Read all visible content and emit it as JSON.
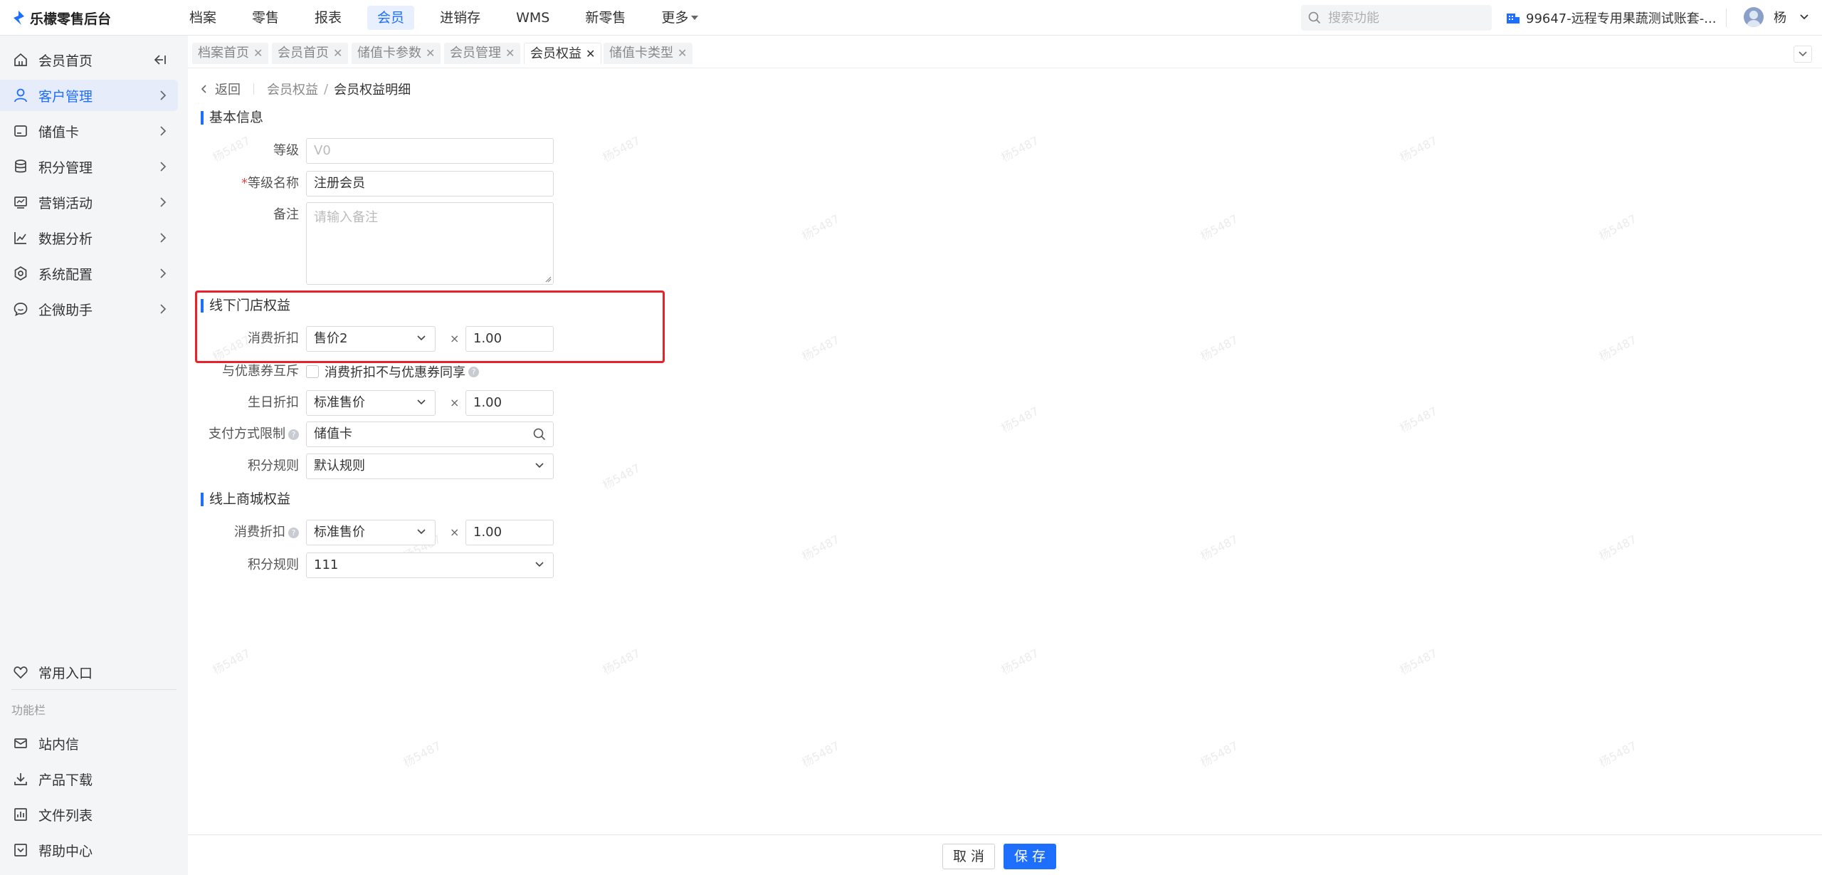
{
  "app": {
    "title": "乐檬零售后台"
  },
  "topnav": [
    "档案",
    "零售",
    "报表",
    "会员",
    "进销存",
    "WMS",
    "新零售",
    "更多"
  ],
  "search": {
    "placeholder": "搜索功能"
  },
  "store": {
    "name": "99647-远程专用果蔬测试账套-..."
  },
  "user": {
    "name": "杨"
  },
  "sidebar": {
    "items": [
      {
        "label": "会员首页",
        "icon": "home-icon"
      },
      {
        "label": "客户管理",
        "icon": "user-icon"
      },
      {
        "label": "储值卡",
        "icon": "card-icon"
      },
      {
        "label": "积分管理",
        "icon": "database-icon"
      },
      {
        "label": "营销活动",
        "icon": "monitor-icon"
      },
      {
        "label": "数据分析",
        "icon": "chart-icon"
      },
      {
        "label": "系统配置",
        "icon": "settings-icon"
      },
      {
        "label": "企微助手",
        "icon": "chat-icon"
      }
    ],
    "favorites": "常用入口",
    "section_caption": "功能栏",
    "bottom_items": [
      {
        "label": "站内信",
        "icon": "mail-icon"
      },
      {
        "label": "产品下载",
        "icon": "download-icon"
      },
      {
        "label": "文件列表",
        "icon": "file-list-icon"
      },
      {
        "label": "帮助中心",
        "icon": "help-icon"
      }
    ]
  },
  "tabs": [
    "档案首页",
    "会员首页",
    "储值卡参数",
    "会员管理",
    "会员权益",
    "储值卡类型"
  ],
  "breadcrumb": {
    "back": "返回",
    "parent": "会员权益",
    "current": "会员权益明细"
  },
  "watermark": "杨5487",
  "basic_info": {
    "title": "基本信息",
    "level_label": "等级",
    "level_value": "V0",
    "level_name_label": "等级名称",
    "level_name_value": "注册会员",
    "remark_label": "备注",
    "remark_placeholder": "请输入备注"
  },
  "offline": {
    "title": "线下门店权益",
    "discount_label": "消费折扣",
    "discount_select": "售价2",
    "discount_mult": "1.00",
    "coupon_label": "与优惠券互斥",
    "coupon_checkbox": "消费折扣不与优惠券同享",
    "birthday_label": "生日折扣",
    "birthday_select": "标准售价",
    "birthday_mult": "1.00",
    "payment_label": "支付方式限制",
    "payment_value": "储值卡",
    "points_label": "积分规则",
    "points_value": "默认规则"
  },
  "online": {
    "title": "线上商城权益",
    "discount_label": "消费折扣",
    "discount_select": "标准售价",
    "discount_mult": "1.00",
    "points_label": "积分规则",
    "points_value": "111"
  },
  "times_symbol": "×",
  "footer": {
    "cancel": "取 消",
    "save": "保 存"
  },
  "colors": {
    "accent": "#1f6fff",
    "highlight": "#e8212b"
  }
}
